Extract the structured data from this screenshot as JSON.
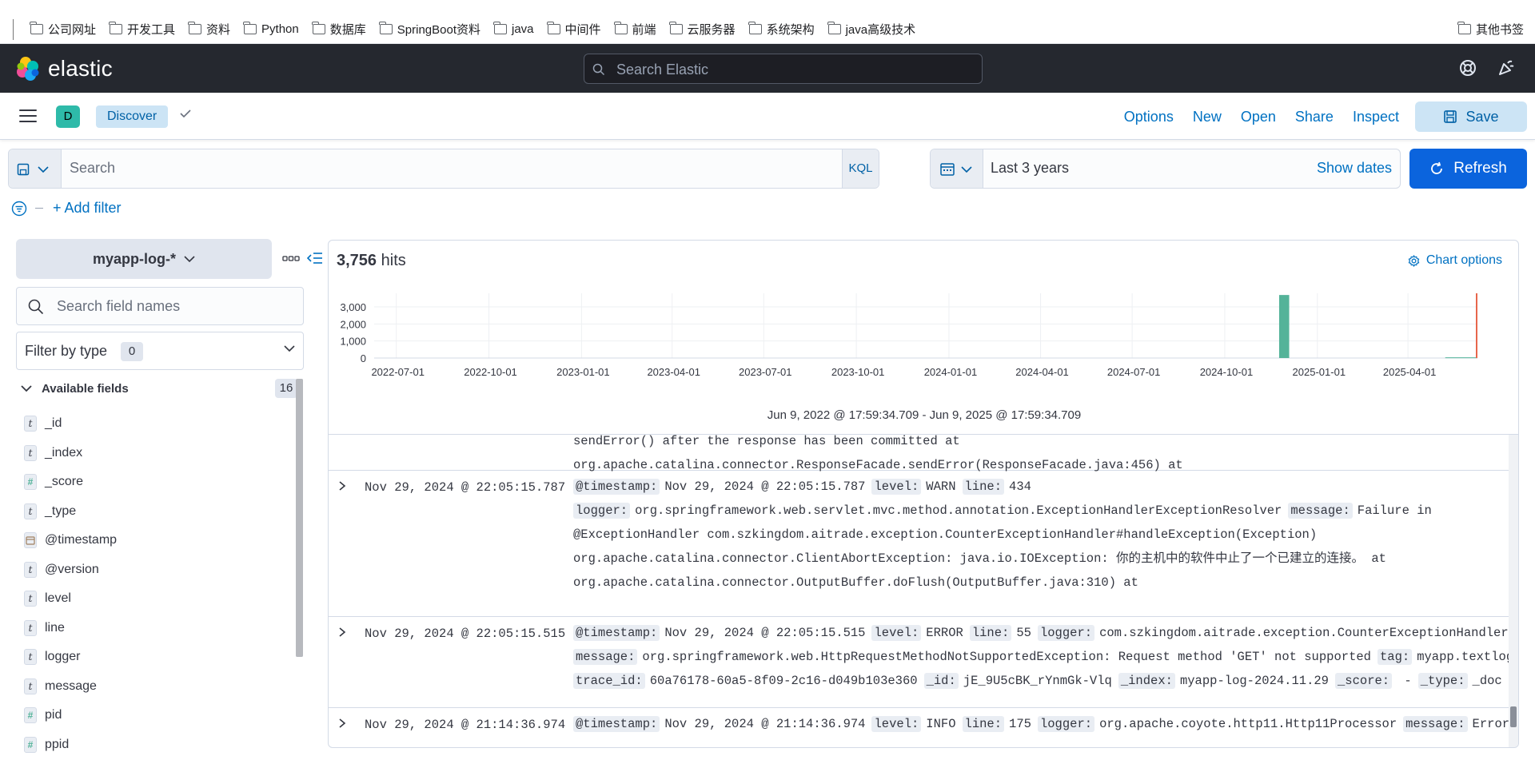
{
  "bookmarks": {
    "items": [
      "公司网址",
      "开发工具",
      "资料",
      "Python",
      "数据库",
      "SpringBoot资料",
      "java",
      "中间件",
      "前端",
      "云服务器",
      "系统架构",
      "java高级技术"
    ],
    "other": "其他书签"
  },
  "header": {
    "brand": "elastic",
    "search_placeholder": "Search Elastic"
  },
  "appbar": {
    "space_initial": "D",
    "breadcrumb": "Discover",
    "links": [
      "Options",
      "New",
      "Open",
      "Share",
      "Inspect"
    ],
    "save_label": "Save"
  },
  "query": {
    "placeholder": "Search",
    "language": "KQL",
    "time_range": "Last 3 years",
    "show_dates": "Show dates",
    "refresh_label": "Refresh",
    "add_filter": "+ Add filter"
  },
  "sidebar": {
    "index_pattern": "myapp-log-*",
    "field_search_placeholder": "Search field names",
    "filter_by_type": "Filter by type",
    "filter_count": "0",
    "available_title": "Available fields",
    "available_count": "16",
    "fields": [
      {
        "type": "t",
        "name": "_id"
      },
      {
        "type": "t",
        "name": "_index"
      },
      {
        "type": "#",
        "name": "_score"
      },
      {
        "type": "t",
        "name": "_type"
      },
      {
        "type": "date",
        "name": "@timestamp"
      },
      {
        "type": "t",
        "name": "@version"
      },
      {
        "type": "t",
        "name": "level"
      },
      {
        "type": "t",
        "name": "line"
      },
      {
        "type": "t",
        "name": "logger"
      },
      {
        "type": "t",
        "name": "message"
      },
      {
        "type": "#",
        "name": "pid"
      },
      {
        "type": "#",
        "name": "ppid"
      }
    ]
  },
  "main": {
    "hits_count": "3,756",
    "hits_label": "hits",
    "chart_options": "Chart options",
    "time_range_text": "Jun 9, 2022 @ 17:59:34.709 - Jun 9, 2025 @ 17:59:34.709"
  },
  "chart_data": {
    "type": "bar",
    "y_ticks": [
      "3,000",
      "2,000",
      "1,000",
      "0"
    ],
    "ylim": [
      0,
      3800
    ],
    "x_ticks": [
      "2022-07-01",
      "2022-10-01",
      "2023-01-01",
      "2023-04-01",
      "2023-07-01",
      "2023-10-01",
      "2024-01-01",
      "2024-04-01",
      "2024-07-01",
      "2024-10-01",
      "2025-01-01",
      "2025-04-01"
    ],
    "bars": [
      {
        "start": "2024-11-24",
        "end": "2024-12-04",
        "value": 3700,
        "color": "#54b399"
      },
      {
        "start": "2025-05-08",
        "end": "2025-06-09",
        "value": 40,
        "color": "#54b399"
      }
    ],
    "now_marker": "2025-06-09",
    "now_color": "#e7664c",
    "grid": true
  },
  "documents": [
    {
      "timestamp": "",
      "lines": [
        [
          {
            "t": "v",
            "s": "sendError() after the response has been committed at"
          }
        ],
        [
          {
            "t": "v",
            "s": "org.apache.catalina.connector.ResponseFacade.sendError(ResponseFacade.java:456) at"
          }
        ]
      ]
    },
    {
      "timestamp": "Nov 29, 2024 @ 22:05:15.787",
      "lines": [
        [
          {
            "t": "k",
            "s": "@timestamp:"
          },
          {
            "t": "v",
            "s": "Nov 29, 2024 @ 22:05:15.787"
          },
          {
            "t": "k",
            "s": "level:"
          },
          {
            "t": "v",
            "s": "WARN"
          },
          {
            "t": "k",
            "s": "line:"
          },
          {
            "t": "v",
            "s": "434"
          }
        ],
        [
          {
            "t": "k",
            "s": "logger:"
          },
          {
            "t": "v",
            "s": "org.springframework.web.servlet.mvc.method.annotation.ExceptionHandlerExceptionResolver"
          },
          {
            "t": "k",
            "s": "message:"
          },
          {
            "t": "v",
            "s": "Failure in"
          }
        ],
        [
          {
            "t": "v",
            "s": "@ExceptionHandler com.szkingdom.aitrade.exception.CounterExceptionHandler#handleException(Exception)"
          }
        ],
        [
          {
            "t": "v",
            "s": "org.apache.catalina.connector.ClientAbortException: java.io.IOException: 你的主机中的软件中止了一个已建立的连接。 at"
          }
        ],
        [
          {
            "t": "v",
            "s": "org.apache.catalina.connector.OutputBuffer.doFlush(OutputBuffer.java:310) at"
          }
        ]
      ]
    },
    {
      "timestamp": "Nov 29, 2024 @ 22:05:15.515",
      "lines": [
        [
          {
            "t": "k",
            "s": "@timestamp:"
          },
          {
            "t": "v",
            "s": "Nov 29, 2024 @ 22:05:15.515"
          },
          {
            "t": "k",
            "s": "level:"
          },
          {
            "t": "v",
            "s": "ERROR"
          },
          {
            "t": "k",
            "s": "line:"
          },
          {
            "t": "v",
            "s": "55"
          },
          {
            "t": "k",
            "s": "logger:"
          },
          {
            "t": "v",
            "s": "com.szkingdom.aitrade.exception.CounterExceptionHandler"
          }
        ],
        [
          {
            "t": "k",
            "s": "message:"
          },
          {
            "t": "v",
            "s": "org.springframework.web.HttpRequestMethodNotSupportedException: Request method 'GET' not supported"
          },
          {
            "t": "k",
            "s": "tag:"
          },
          {
            "t": "v",
            "s": "myapp.textlog"
          }
        ],
        [
          {
            "t": "k",
            "s": "trace_id:"
          },
          {
            "t": "v",
            "s": "60a76178-60a5-8f09-2c16-d049b103e360"
          },
          {
            "t": "k",
            "s": "_id:"
          },
          {
            "t": "v",
            "s": "jE_9U5cBK_rYnmGk-Vlq"
          },
          {
            "t": "k",
            "s": "_index:"
          },
          {
            "t": "v",
            "s": "myapp-log-2024.11.29"
          },
          {
            "t": "k",
            "s": "_score:"
          },
          {
            "t": "v",
            "s": " -"
          },
          {
            "t": "k",
            "s": "_type:"
          },
          {
            "t": "v",
            "s": "_doc"
          }
        ]
      ]
    },
    {
      "timestamp": "Nov 29, 2024 @ 21:14:36.974",
      "lines": [
        [
          {
            "t": "k",
            "s": "@timestamp:"
          },
          {
            "t": "v",
            "s": "Nov 29, 2024 @ 21:14:36.974"
          },
          {
            "t": "k",
            "s": "level:"
          },
          {
            "t": "v",
            "s": "INFO"
          },
          {
            "t": "k",
            "s": "line:"
          },
          {
            "t": "v",
            "s": "175"
          },
          {
            "t": "k",
            "s": "logger:"
          },
          {
            "t": "v",
            "s": "org.apache.coyote.http11.Http11Processor"
          },
          {
            "t": "k",
            "s": "message:"
          },
          {
            "t": "v",
            "s": "Error"
          }
        ]
      ]
    }
  ]
}
